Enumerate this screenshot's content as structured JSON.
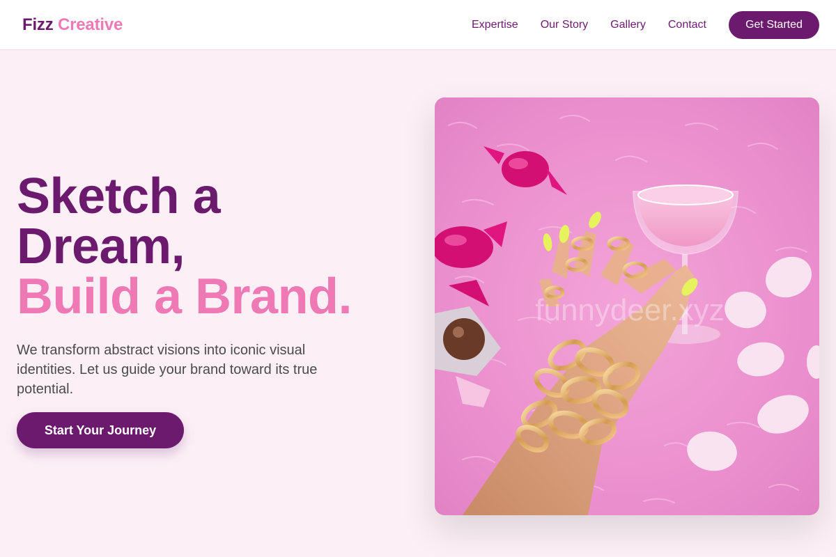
{
  "nav": {
    "brand_first": "Fizz",
    "brand_second": "Creative",
    "links": [
      "Expertise",
      "Our Story",
      "Gallery",
      "Contact"
    ],
    "cta": "Get Started"
  },
  "hero": {
    "title_line1": "Sketch a",
    "title_line2": "Dream,",
    "title_line3": "Build a Brand.",
    "subtitle": "We transform abstract visions into iconic visual identities. Let us guide your brand toward its true potential.",
    "cta": "Start Your Journey",
    "image_watermark": "funnydeer.xyz"
  },
  "colors": {
    "primary": "#6b1a6e",
    "accent": "#ef79b5",
    "background": "#fcf0f6"
  }
}
